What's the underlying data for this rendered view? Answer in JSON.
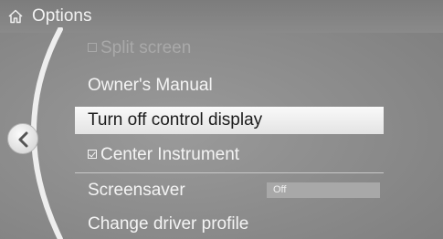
{
  "header": {
    "title": "Options",
    "icon": "home-icon"
  },
  "back_button": {
    "icon": "chevron-left-icon"
  },
  "menu": {
    "items": [
      {
        "label": "Split screen",
        "state": "disabled",
        "checkbox": "unchecked"
      },
      {
        "label": "Owner's Manual"
      },
      {
        "label": "Turn off control display",
        "state": "selected"
      },
      {
        "label": "Center Instrument",
        "checkbox": "checked"
      },
      {
        "label": "Screensaver",
        "value": "Off"
      },
      {
        "label": "Change driver profile"
      }
    ]
  },
  "colors": {
    "background": "#8f8f8f",
    "highlight": "#f2f2f2",
    "text": "#f4f4f4"
  }
}
